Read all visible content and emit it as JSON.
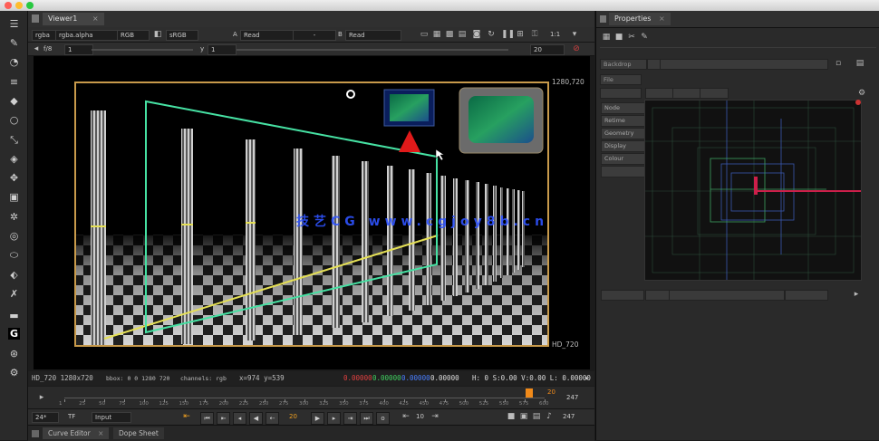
{
  "window": {
    "traffic_lights": [
      "#fe5f57",
      "#febc2e",
      "#28c840"
    ]
  },
  "viewer": {
    "tab_label": "Viewer1",
    "row1": {
      "proxy": "rgba",
      "channel": "rgba.alpha",
      "colorspace": "RGB",
      "alpha": "sRGB",
      "a_label": "A",
      "a_input": "Read",
      "composite": "-",
      "b_label": "B",
      "b_input": "Read",
      "zoom": "1:1"
    },
    "row2": {
      "gain": "f/8",
      "gain_value": "1",
      "gamma_label": "y",
      "gamma_value": "1",
      "frame": "20"
    },
    "format_top": "1280,720",
    "format_bottom": "HD_720",
    "watermark": "技艺CG www.cgjoy8b.cn"
  },
  "status": {
    "format": "HD_720 1280x720",
    "bbox": "bbox: 0 0 1280 720",
    "channels": "channels: rgb",
    "coords": "x=974 y=539",
    "r": "0.00000",
    "g": "0.00000",
    "b": "0.00000",
    "a": "0.00000",
    "hsvl": "H: 0 S:0.00 V:0.00 L: 0.00000"
  },
  "timeline": {
    "ticks": [
      "1",
      "25",
      "50",
      "75",
      "100",
      "125",
      "150",
      "175",
      "200",
      "225",
      "250",
      "275",
      "300",
      "325",
      "350",
      "375",
      "400",
      "425",
      "450",
      "475",
      "500",
      "525",
      "550",
      "575",
      "600"
    ],
    "start": "1",
    "end": "247",
    "current_marker": "20",
    "playhead_fraction": 0.96
  },
  "transport": {
    "fps": "24*",
    "tf": "TF",
    "mode": "Input",
    "frame": "20",
    "step": "10",
    "end_frame": "247"
  },
  "bottom_tabs": [
    "Curve Editor",
    "Dope Sheet"
  ],
  "properties": {
    "tab_label": "Properties",
    "dropdown": "Backdrop",
    "side_buttons": [
      "Node",
      "Retime",
      "Geometry",
      "Display",
      "Colour"
    ],
    "preview_highlight_color": "#cc1f4a"
  },
  "canvas": {
    "frame_color": "#c89a4b",
    "plane_color": "#46e1a3",
    "guide_color": "#e5e055",
    "marker_color": "#e01a1a"
  }
}
